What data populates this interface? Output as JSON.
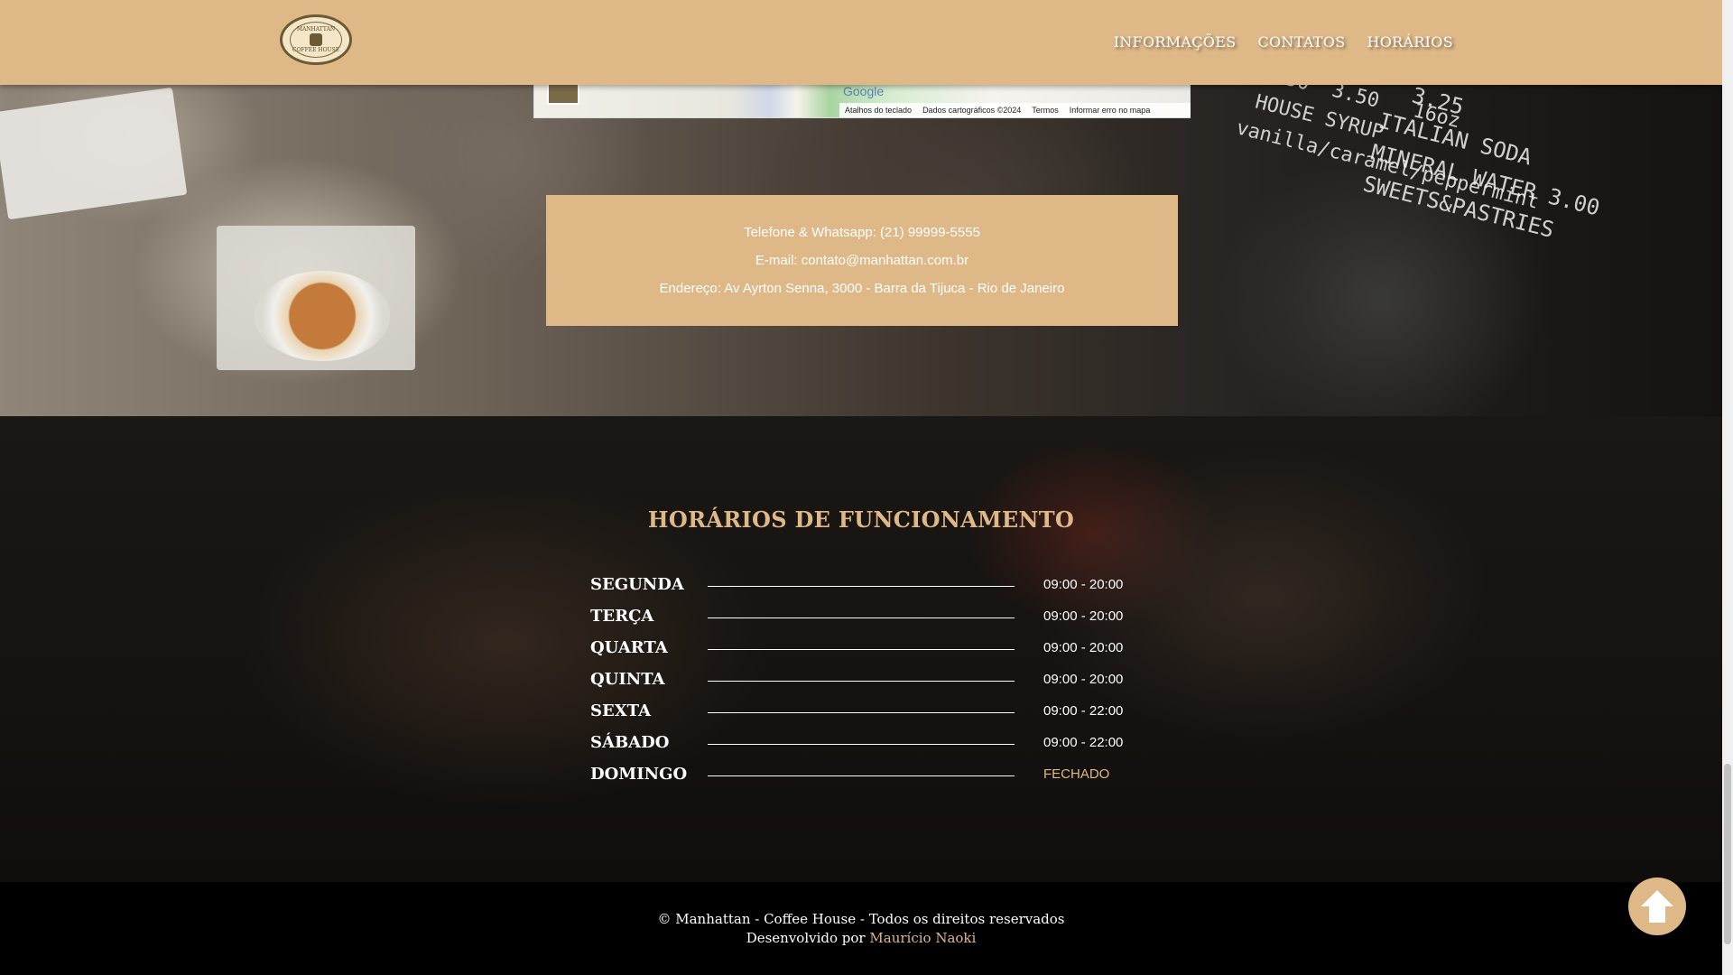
{
  "brand": {
    "logo_text_top": "MANHATTAN",
    "logo_text_bottom": "COFFEE HOUSE"
  },
  "nav": {
    "items": [
      {
        "label": "INFORMAÇÕES"
      },
      {
        "label": "CONTATOS"
      },
      {
        "label": "HORÁRIOS"
      }
    ]
  },
  "map": {
    "google_label": "Google",
    "attribution": {
      "shortcuts": "Atalhos do teclado",
      "data": "Dados cartográficos ©2024",
      "terms": "Termos",
      "report": "Informar erro no mapa"
    }
  },
  "contact": {
    "phone": "Telefone & Whatsapp: (21) 99999-5555",
    "email": "E-mail: contato@manhattan.com.br",
    "address": "Endereço: Av Ayrton Senna, 3000 - Barra da Tijuca - Rio de Janeiro"
  },
  "hours": {
    "title": "HORÁRIOS DE FUNCIONAMENTO",
    "rows": [
      {
        "day": "SEGUNDA",
        "time": "09:00 - 20:00"
      },
      {
        "day": "TERÇA",
        "time": "09:00 - 20:00"
      },
      {
        "day": "QUARTA",
        "time": "09:00 - 20:00"
      },
      {
        "day": "QUINTA",
        "time": "09:00 - 20:00"
      },
      {
        "day": "SEXTA",
        "time": "09:00 - 22:00"
      },
      {
        "day": "SÁBADO",
        "time": "09:00 - 22:00"
      },
      {
        "day": "DOMINGO",
        "time": "FECHADO"
      }
    ]
  },
  "footer": {
    "copyright": "© Manhattan - Coffee House - Todos os direitos reservados",
    "developed_by": "Desenvolvido por",
    "author": "Maurício Naoki"
  },
  "colors": {
    "accent": "#deb887",
    "dark": "#000000"
  },
  "icons": {
    "back_to_top": "arrow-up-icon"
  }
}
